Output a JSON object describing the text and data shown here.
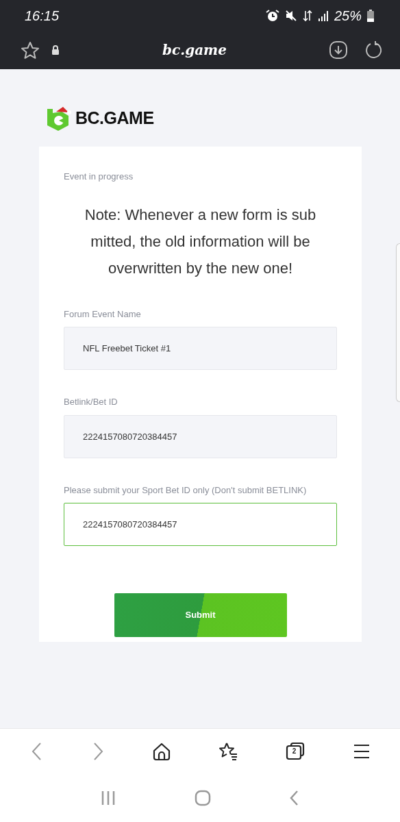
{
  "status_bar": {
    "time": "16:15",
    "battery": "25%"
  },
  "address_bar": {
    "url": "bc.game"
  },
  "logo": {
    "text": "BC.GAME"
  },
  "form": {
    "notice": "Event in progress",
    "note": "Note: Whenever a new form is sub mitted, the old information will be overwritten by the new one!",
    "fields": [
      {
        "label": "Forum Event Name",
        "value": "NFL Freebet Ticket #1",
        "focused": false
      },
      {
        "label": "Betlink/Bet ID",
        "value": "2224157080720384457",
        "focused": false
      },
      {
        "label": "Please submit your Sport Bet ID only (Don't submit BETLINK)",
        "value": "2224157080720384457",
        "focused": true
      }
    ],
    "submit": "Submit"
  },
  "toolbar": {
    "tabs_count": "2"
  }
}
